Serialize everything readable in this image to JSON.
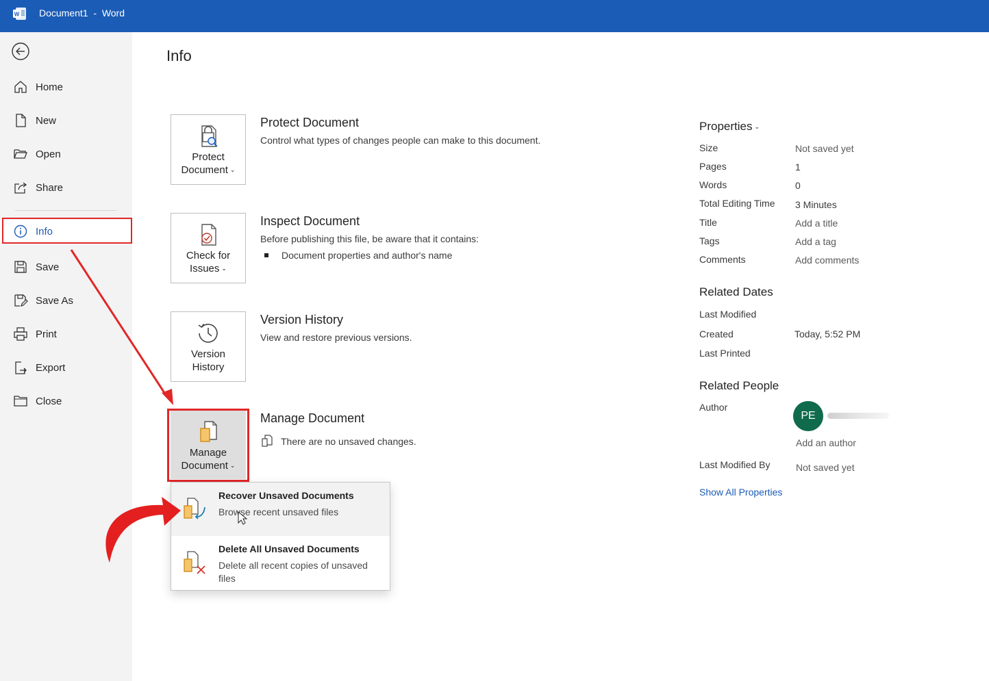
{
  "window": {
    "title": "Document1  -  Word"
  },
  "sidebar": {
    "items": [
      {
        "label": "Home",
        "icon": "home-icon"
      },
      {
        "label": "New",
        "icon": "new-document-icon"
      },
      {
        "label": "Open",
        "icon": "folder-open-icon"
      },
      {
        "label": "Share",
        "icon": "share-icon"
      },
      {
        "label": "Info",
        "icon": "info-icon",
        "active": true
      },
      {
        "label": "Save",
        "icon": "save-icon"
      },
      {
        "label": "Save As",
        "icon": "save-as-icon"
      },
      {
        "label": "Print",
        "icon": "printer-icon"
      },
      {
        "label": "Export",
        "icon": "export-icon"
      },
      {
        "label": "Close",
        "icon": "folder-close-icon"
      }
    ]
  },
  "main": {
    "title": "Info",
    "sections": {
      "protect": {
        "button_line1": "Protect",
        "button_line2": "Document",
        "title": "Protect Document",
        "desc": "Control what types of changes people can make to this document."
      },
      "inspect": {
        "button_line1": "Check for",
        "button_line2": "Issues",
        "title": "Inspect Document",
        "desc": "Before publishing this file, be aware that it contains:",
        "bullet": "Document properties and author's name"
      },
      "version": {
        "button_line1": "Version",
        "button_line2": "History",
        "title": "Version History",
        "desc": "View and restore previous versions."
      },
      "manage": {
        "button_line1": "Manage",
        "button_line2": "Document",
        "title": "Manage Document",
        "desc": "There are no unsaved changes."
      }
    },
    "dropdown": {
      "items": [
        {
          "title": "Recover Unsaved Documents",
          "desc": "Browse recent unsaved files"
        },
        {
          "title": "Delete All Unsaved Documents",
          "desc": "Delete all recent copies of unsaved files"
        }
      ]
    }
  },
  "properties": {
    "heading": "Properties",
    "rows": [
      {
        "label": "Size",
        "value": "Not saved yet"
      },
      {
        "label": "Pages",
        "value": "1"
      },
      {
        "label": "Words",
        "value": "0"
      },
      {
        "label": "Total Editing Time",
        "value": "3 Minutes"
      },
      {
        "label": "Title",
        "value": "Add a title"
      },
      {
        "label": "Tags",
        "value": "Add a tag"
      },
      {
        "label": "Comments",
        "value": "Add comments"
      }
    ],
    "related_dates": {
      "heading": "Related Dates",
      "rows": [
        {
          "label": "Last Modified",
          "value": ""
        },
        {
          "label": "Created",
          "value": "Today, 5:52 PM"
        },
        {
          "label": "Last Printed",
          "value": ""
        }
      ]
    },
    "related_people": {
      "heading": "Related People",
      "author_label": "Author",
      "author_initials": "PE",
      "add_author": "Add an author",
      "last_modified_by_label": "Last Modified By",
      "last_modified_by_value": "Not saved yet"
    },
    "show_all": "Show All Properties"
  },
  "colors": {
    "titlebar": "#1b5cb6",
    "highlight": "#e12727",
    "avatar": "#0f6b4b",
    "link": "#1b5cb6"
  }
}
